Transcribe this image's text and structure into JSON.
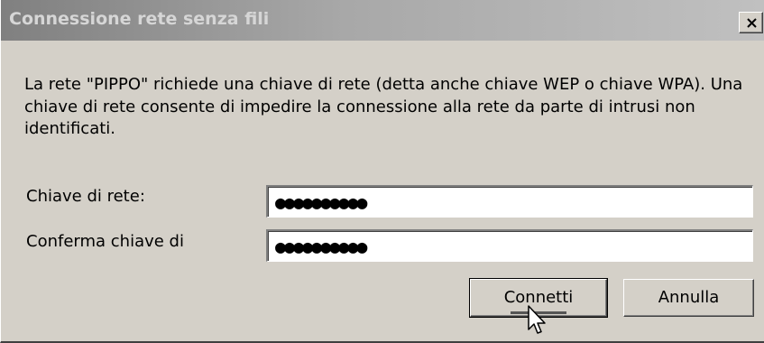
{
  "window": {
    "title": "Connessione rete senza fili",
    "close_glyph": "X"
  },
  "message": "La rete \"PIPPO\" richiede una chiave di rete (detta anche chiave WEP o chiave WPA). Una chiave di rete consente di impedire la connessione alla rete da parte di intrusi non identificati.",
  "fields": {
    "network_key": {
      "label": "Chiave di rete:",
      "value_masked": "●●●●●●●●●●"
    },
    "confirm_key": {
      "label": "Conferma chiave di",
      "value_masked": "●●●●●●●●●●"
    }
  },
  "buttons": {
    "connect": "Connetti",
    "cancel": "Annulla"
  },
  "colors": {
    "dialog_bg": "#d4d0c8",
    "titlebar_start": "#808080",
    "titlebar_end": "#c0c0c0",
    "title_text": "#d6d6d6"
  },
  "icons": {
    "close": "close-icon",
    "pointer": "mouse-pointer-icon"
  }
}
